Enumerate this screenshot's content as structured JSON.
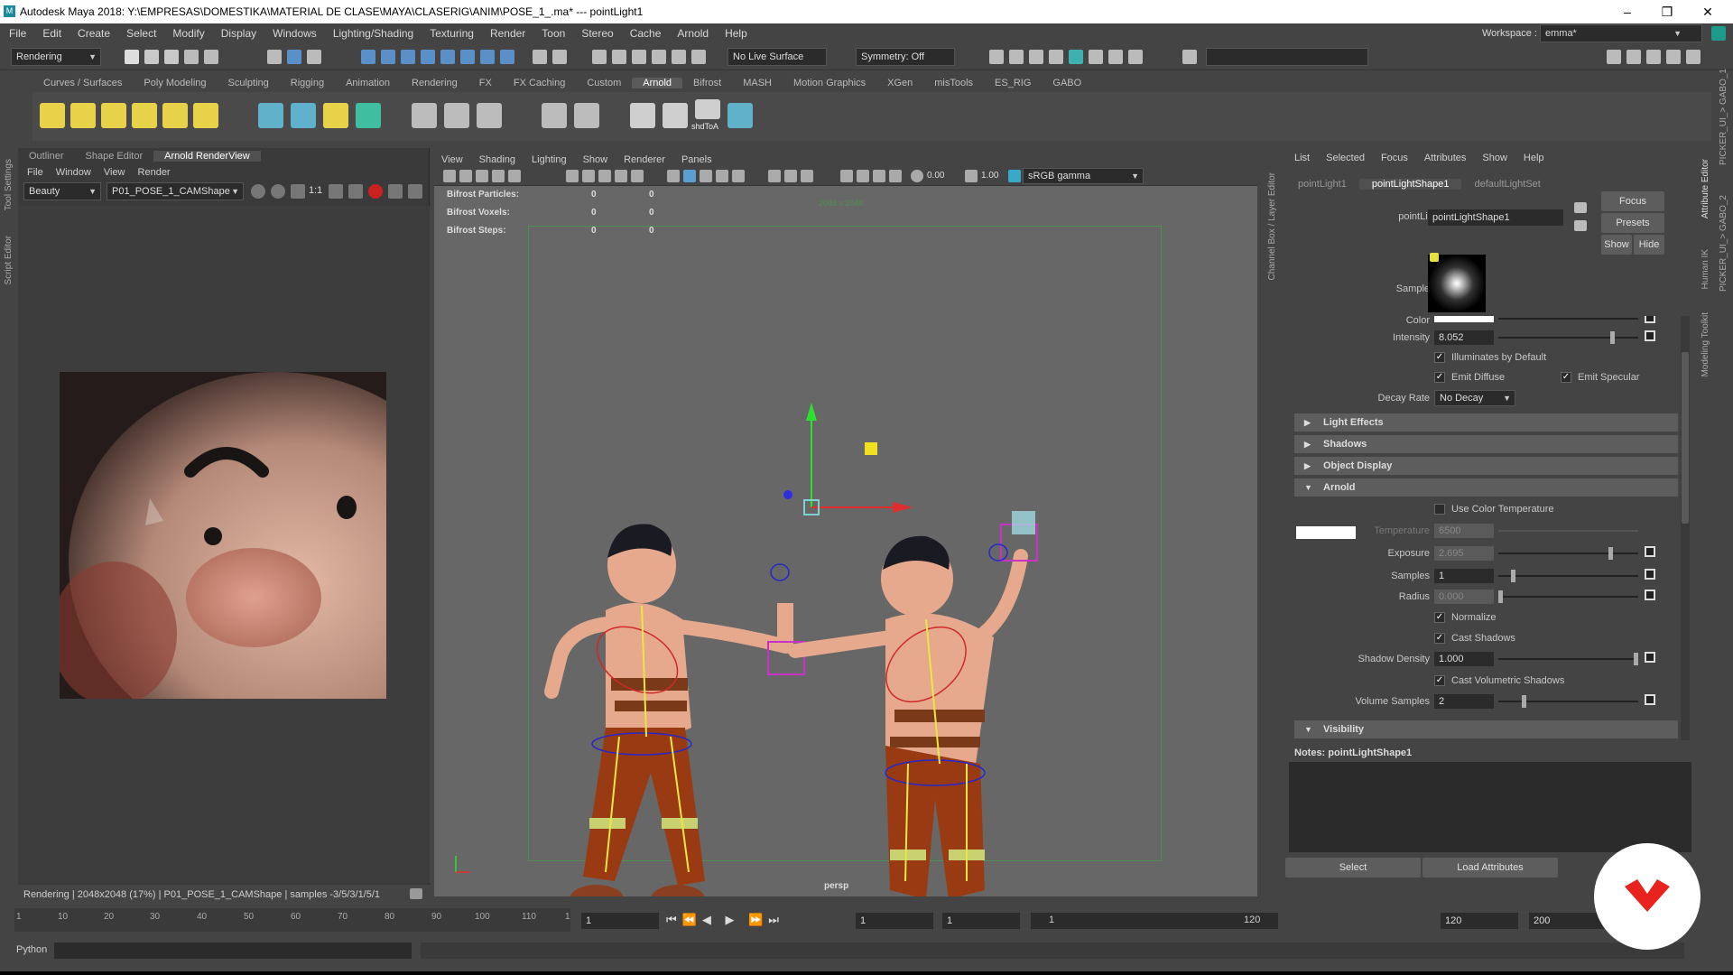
{
  "window": {
    "title": "Autodesk Maya 2018: Y:\\EMPRESAS\\DOMESTIKA\\MATERIAL DE CLASE\\MAYA\\CLASERIG\\ANIM\\POSE_1_.ma*  ---  pointLight1",
    "minimize": "–",
    "maximize": "❐",
    "close": "✕"
  },
  "menubar": [
    "File",
    "Edit",
    "Create",
    "Select",
    "Modify",
    "Display",
    "Windows",
    "Lighting/Shading",
    "Texturing",
    "Render",
    "Toon",
    "Stereo",
    "Cache",
    "Arnold",
    "Help"
  ],
  "workspace": {
    "label": "Workspace :",
    "value": "emma*"
  },
  "statusline": {
    "mode": "Rendering",
    "live_surface": "No Live Surface",
    "symmetry": "Symmetry: Off"
  },
  "shelf_tabs": [
    "Curves / Surfaces",
    "Poly Modeling",
    "Sculpting",
    "Rigging",
    "Animation",
    "Rendering",
    "FX",
    "FX Caching",
    "Custom",
    "Arnold",
    "Bifrost",
    "MASH",
    "Motion Graphics",
    "XGen",
    "misTools",
    "ES_RIG",
    "GABO"
  ],
  "shelf_active": "Arnold",
  "shelf_icon_label": "shdToA",
  "left_panel": {
    "tabs": [
      "Outliner",
      "Shape Editor",
      "Arnold RenderView"
    ],
    "active_tab": "Arnold RenderView",
    "menu": [
      "File",
      "Window",
      "View",
      "Render"
    ],
    "aov": "Beauty",
    "camera": "P01_POSE_1_CAMShape",
    "ratio": "1:1",
    "status": "Rendering | 2048x2048 (17%) | P01_POSE_1_CAMShape | samples -3/5/3/1/5/1"
  },
  "side_labels": {
    "tool_settings": "Tool Settings",
    "script_editor": "Script Editor",
    "channel_box": "Channel Box / Layer Editor",
    "attribute_editor": "Attribute Editor",
    "modeling_toolkit": "Modeling Toolkit",
    "human_ik": "Human IK",
    "picker1": "PICKER_UI_> GABO_1",
    "picker2": "PICKER_UI_> GABO_2"
  },
  "viewport": {
    "menu": [
      "View",
      "Shading",
      "Lighting",
      "Show",
      "Renderer",
      "Panels"
    ],
    "exposure": "0.00",
    "gamma": "1.00",
    "colorspace": "sRGB gamma",
    "hud": [
      {
        "label": "Bifrost Particles:",
        "a": "0",
        "b": "0"
      },
      {
        "label": "Bifrost Voxels:",
        "a": "0",
        "b": "0"
      },
      {
        "label": "Bifrost Steps:",
        "a": "0",
        "b": "0"
      }
    ],
    "resolution": "2048 x 2048",
    "camera_label": "persp"
  },
  "attribute_editor": {
    "menu": [
      "List",
      "Selected",
      "Focus",
      "Attributes",
      "Show",
      "Help"
    ],
    "tabs": [
      "pointLight1",
      "pointLightShape1",
      "defaultLightSet"
    ],
    "active_tab": "pointLightShape1",
    "node_label": "pointLight:",
    "node_value": "pointLightShape1",
    "buttons": {
      "focus": "Focus",
      "presets": "Presets",
      "show": "Show",
      "hide": "Hide"
    },
    "sample_label": "Sample",
    "color_label": "Color",
    "intensity": {
      "label": "Intensity",
      "value": "8.052",
      "level": 0.8
    },
    "illuminates": "Illuminates by Default",
    "emit_diffuse": "Emit Diffuse",
    "emit_specular": "Emit Specular",
    "decay": {
      "label": "Decay Rate",
      "value": "No Decay"
    },
    "sections": [
      "Light Effects",
      "Shadows",
      "Object Display",
      "Arnold"
    ],
    "arnold": {
      "use_color_temp": "Use Color Temperature",
      "temperature": {
        "label": "Temperature",
        "value": "6500"
      },
      "exposure": {
        "label": "Exposure",
        "value": "2.695"
      },
      "samples": {
        "label": "Samples",
        "value": "1"
      },
      "radius": {
        "label": "Radius",
        "value": "0.000"
      },
      "normalize": "Normalize",
      "cast_shadows": "Cast Shadows",
      "shadow_density": {
        "label": "Shadow Density",
        "value": "1.000"
      },
      "cast_volumetric": "Cast Volumetric Shadows",
      "volume_samples": {
        "label": "Volume Samples",
        "value": "2"
      }
    },
    "visibility": "Visibility",
    "notes": "Notes:  pointLightShape1",
    "bottom_buttons": [
      "Select",
      "Load Attributes"
    ]
  },
  "timeline": {
    "ticks": [
      "1",
      "10",
      "20",
      "30",
      "40",
      "50",
      "60",
      "70",
      "80",
      "90",
      "100",
      "110",
      "1"
    ],
    "current_frame": "1",
    "range_start": "1",
    "range_start2": "1",
    "range_slider_start": "1",
    "range_slider_end": "120",
    "end": "120",
    "end2": "200"
  },
  "cmdline": {
    "label": "Python"
  }
}
